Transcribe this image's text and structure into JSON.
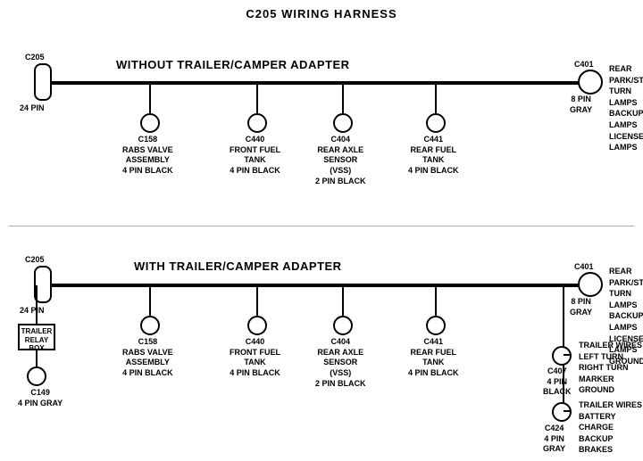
{
  "title": "C205 WIRING HARNESS",
  "section1": {
    "label": "WITHOUT  TRAILER/CAMPER  ADAPTER",
    "left_connector": {
      "id": "C205",
      "pin_label": "24 PIN"
    },
    "right_connector": {
      "id": "C401",
      "pin_label": "8 PIN\nGRAY",
      "right_text": "REAR PARK/STOP\nTURN LAMPS\nBACKUP LAMPS\nLICENSE LAMPS"
    },
    "connectors": [
      {
        "id": "C158",
        "label": "C158\nRABS VALVE\nASSEMBLY\n4 PIN BLACK"
      },
      {
        "id": "C440",
        "label": "C440\nFRONT FUEL\nTANK\n4 PIN BLACK"
      },
      {
        "id": "C404",
        "label": "C404\nREAR AXLE\nSENSOR\n(VSS)\n2 PIN BLACK"
      },
      {
        "id": "C441",
        "label": "C441\nREAR FUEL\nTANK\n4 PIN BLACK"
      }
    ]
  },
  "section2": {
    "label": "WITH  TRAILER/CAMPER  ADAPTER",
    "left_connector": {
      "id": "C205",
      "pin_label": "24 PIN"
    },
    "right_connector": {
      "id": "C401",
      "pin_label": "8 PIN\nGRAY",
      "right_text": "REAR PARK/STOP\nTURN LAMPS\nBACKUP LAMPS\nLICENSE LAMPS\nGROUND"
    },
    "trailer_relay": {
      "label": "TRAILER\nRELAY\nBOX"
    },
    "c149": {
      "label": "C149\n4 PIN GRAY"
    },
    "connectors": [
      {
        "id": "C158",
        "label": "C158\nRABS VALVE\nASSEMBLY\n4 PIN BLACK"
      },
      {
        "id": "C440",
        "label": "C440\nFRONT FUEL\nTANK\n4 PIN BLACK"
      },
      {
        "id": "C404",
        "label": "C404\nREAR AXLE\nSENSOR\n(VSS)\n2 PIN BLACK"
      },
      {
        "id": "C441",
        "label": "C441\nREAR FUEL\nTANK\n4 PIN BLACK"
      }
    ],
    "c407": {
      "label": "C407\n4 PIN\nBLACK",
      "right_text": "TRAILER WIRES\nLEFT TURN\nRIGHT TURN\nMARKER\nGROUND"
    },
    "c424": {
      "label": "C424\n4 PIN\nGRAY",
      "right_text": "TRAILER WIRES\nBATTERY CHARGE\nBACKUP\nBRAKES"
    }
  }
}
